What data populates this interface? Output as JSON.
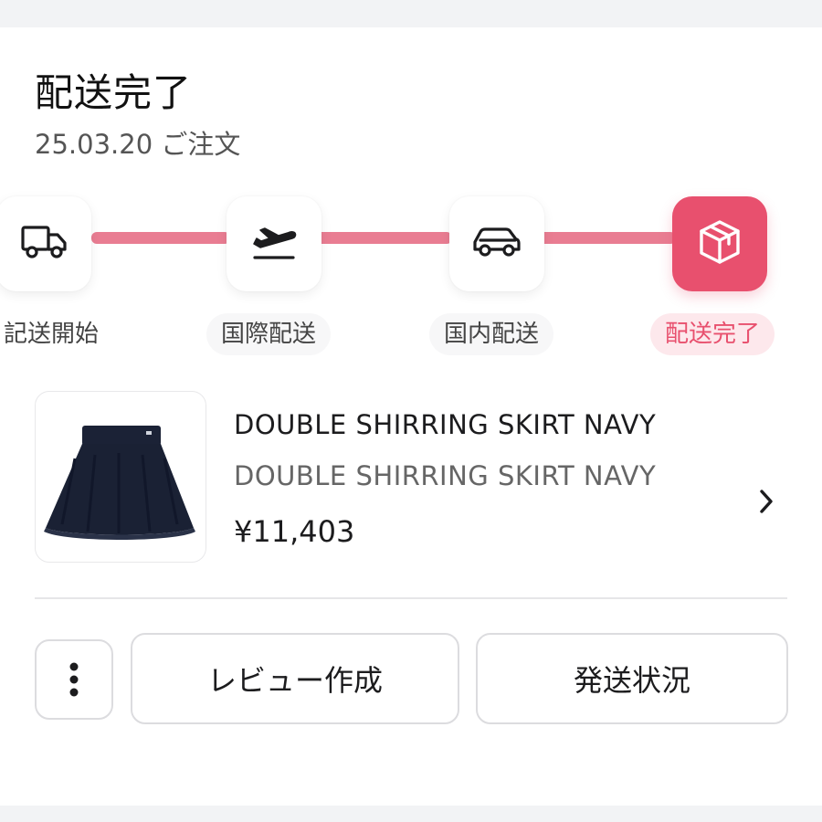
{
  "order": {
    "status_title": "配送完了",
    "date_text": "25.03.20 ご注文"
  },
  "tracker": {
    "accent_color": "#e8506e",
    "line_color": "#e97d92",
    "steps": [
      {
        "label": "配送開始",
        "icon": "delivery-truck-icon"
      },
      {
        "label": "国際配送",
        "icon": "airplane-departure-icon"
      },
      {
        "label": "国内配送",
        "icon": "car-icon"
      },
      {
        "label": "配送完了",
        "icon": "package-box-icon"
      }
    ],
    "step_label_partial": "記送開始"
  },
  "product": {
    "name": "DOUBLE SHIRRING SKIRT NAVY",
    "option": "DOUBLE SHIRRING SKIRT NAVY",
    "price": "¥11,403",
    "image": "navy-skirt-image"
  },
  "actions": {
    "more_icon": "vertical-dots-icon",
    "review_label": "レビュー作成",
    "shipping_status_label": "発送状況"
  }
}
